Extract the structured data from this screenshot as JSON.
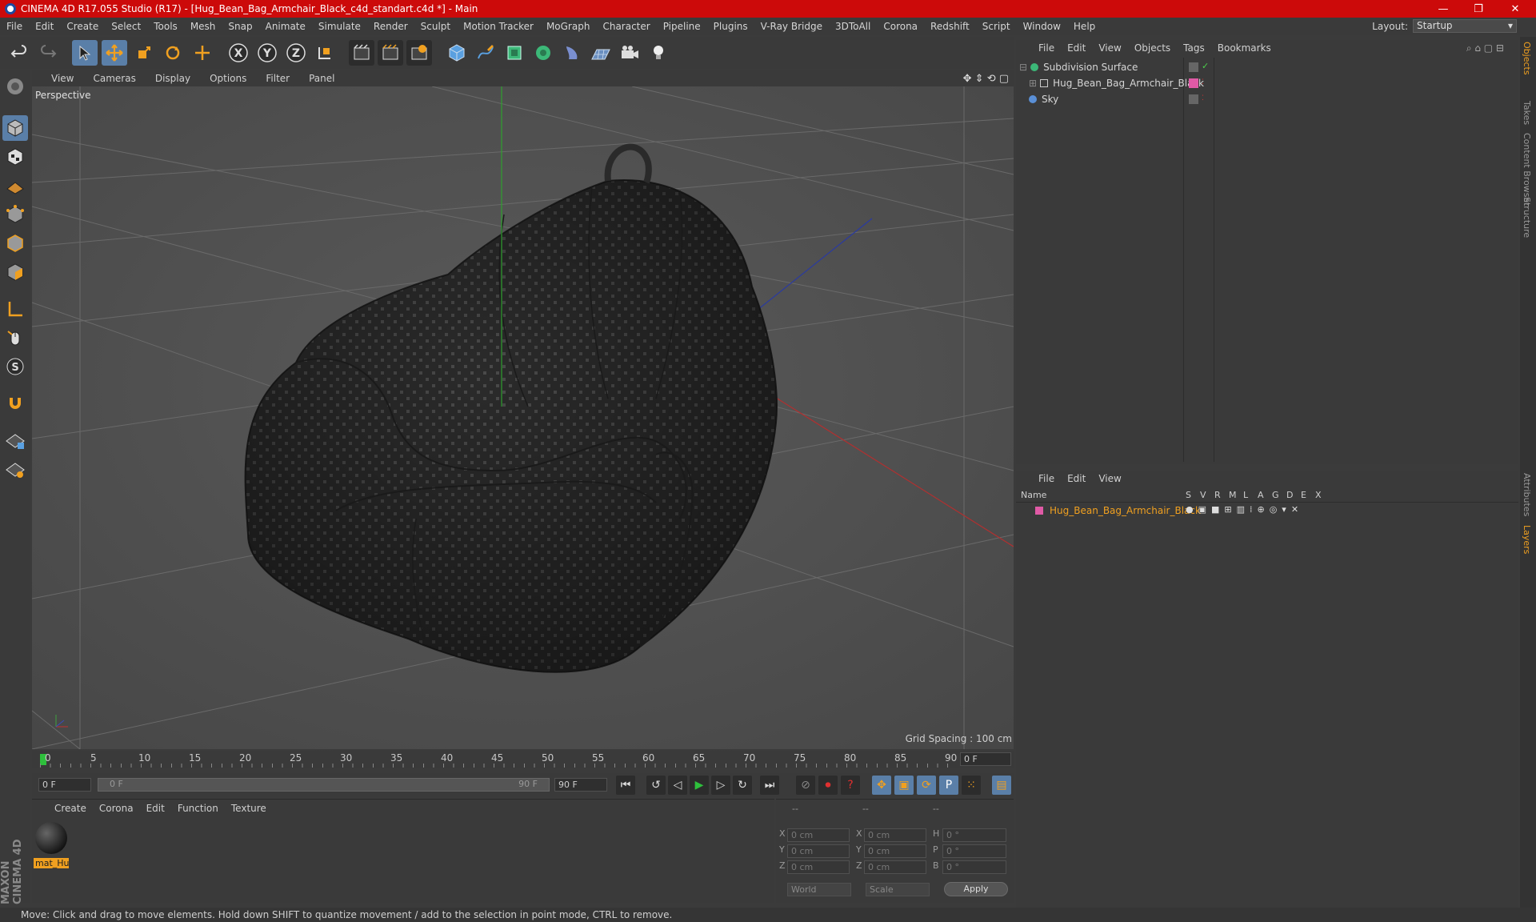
{
  "window": {
    "title": "CINEMA 4D R17.055 Studio (R17) - [Hug_Bean_Bag_Armchair_Black_c4d_standart.c4d *] - Main",
    "minimize": "—",
    "maximize": "❐",
    "close": "✕"
  },
  "menu": [
    "File",
    "Edit",
    "Create",
    "Select",
    "Tools",
    "Mesh",
    "Snap",
    "Animate",
    "Simulate",
    "Render",
    "Sculpt",
    "Motion Tracker",
    "MoGraph",
    "Character",
    "Pipeline",
    "Plugins",
    "V-Ray Bridge",
    "3DToAll",
    "Corona",
    "Redshift",
    "Script",
    "Window",
    "Help"
  ],
  "layout": {
    "label": "Layout:",
    "value": "Startup"
  },
  "viewport": {
    "menu": [
      "View",
      "Cameras",
      "Display",
      "Options",
      "Filter",
      "Panel"
    ],
    "camera_label": "Perspective",
    "grid_spacing": "Grid Spacing : 100 cm"
  },
  "timeline": {
    "ticks": [
      "0",
      "5",
      "10",
      "15",
      "20",
      "25",
      "30",
      "35",
      "40",
      "45",
      "50",
      "55",
      "60",
      "65",
      "70",
      "75",
      "80",
      "85",
      "90"
    ],
    "current_frame": "0 F",
    "start_field": "0 F",
    "range_start": "0 F",
    "range_end": "90 F",
    "end_field": "90 F"
  },
  "material_panel": {
    "menu": [
      "Create",
      "Corona",
      "Edit",
      "Function",
      "Texture"
    ],
    "material_name": "mat_Hu"
  },
  "coord_panel": {
    "headers": [
      "--",
      "--",
      "--"
    ],
    "rows": [
      {
        "axis": "X",
        "pos": "0 cm",
        "axis2": "X",
        "size": "0 cm",
        "rot_label": "H",
        "rot": "0 °"
      },
      {
        "axis": "Y",
        "pos": "0 cm",
        "axis2": "Y",
        "size": "0 cm",
        "rot_label": "P",
        "rot": "0 °"
      },
      {
        "axis": "Z",
        "pos": "0 cm",
        "axis2": "Z",
        "size": "0 cm",
        "rot_label": "B",
        "rot": "0 °"
      }
    ],
    "world_select": "World",
    "scale_select": "Scale",
    "apply": "Apply"
  },
  "object_manager": {
    "menu": [
      "File",
      "Edit",
      "View",
      "Objects",
      "Tags",
      "Bookmarks"
    ],
    "objects": [
      {
        "name": "Subdivision Surface",
        "color": "#3cb878"
      },
      {
        "name": "Hug_Bean_Bag_Armchair_Black",
        "color": "#cccccc"
      },
      {
        "name": "Sky",
        "color": "#5a8fd6"
      }
    ]
  },
  "layer_manager": {
    "menu": [
      "File",
      "Edit",
      "View"
    ],
    "col_name": "Name",
    "cols": [
      "S",
      "V",
      "R",
      "M",
      "L",
      "A",
      "G",
      "D",
      "E",
      "X"
    ],
    "layer_name": "Hug_Bean_Bag_Armchair_Black",
    "layer_color": "#e05aa6"
  },
  "right_tabs": [
    "Objects",
    "Takes",
    "Content Browser",
    "Structure",
    "Attributes",
    "Layers"
  ],
  "brand": "MAXON CINEMA 4D",
  "status": "Move: Click and drag to move elements. Hold down SHIFT to quantize movement / add to the selection in point mode, CTRL to remove.",
  "colors": {
    "titlebar": "#cc0a0a",
    "accent_orange": "#f0a020",
    "active_blue": "#5a7fa8"
  }
}
